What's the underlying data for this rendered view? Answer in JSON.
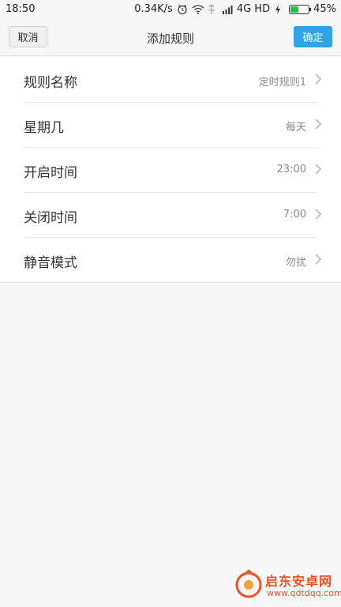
{
  "status_bar": {
    "time": "18:50",
    "speed": "0.34K/s",
    "network": "4G HD",
    "battery": "45%",
    "battery_level": 0.45,
    "icons": [
      "alarm-icon",
      "wifi-icon",
      "signal-muted-icon",
      "signal-bars-icon",
      "charging-icon",
      "battery-icon"
    ]
  },
  "header": {
    "cancel_label": "取消",
    "title": "添加规则",
    "confirm_label": "确定"
  },
  "rows": [
    {
      "label": "规则名称",
      "value": "定时规则1"
    },
    {
      "label": "星期几",
      "value": "每天"
    },
    {
      "label": "开启时间",
      "value": "23:00"
    },
    {
      "label": "关闭时间",
      "value": "7:00"
    },
    {
      "label": "静音模式",
      "value": "勿扰"
    }
  ],
  "watermark": {
    "title": "启东安卓网",
    "url": "www.qdtdqq.com"
  },
  "colors": {
    "accent": "#31a4e6",
    "battery_fill": "#2bbd4a",
    "watermark": "#e9532a"
  }
}
